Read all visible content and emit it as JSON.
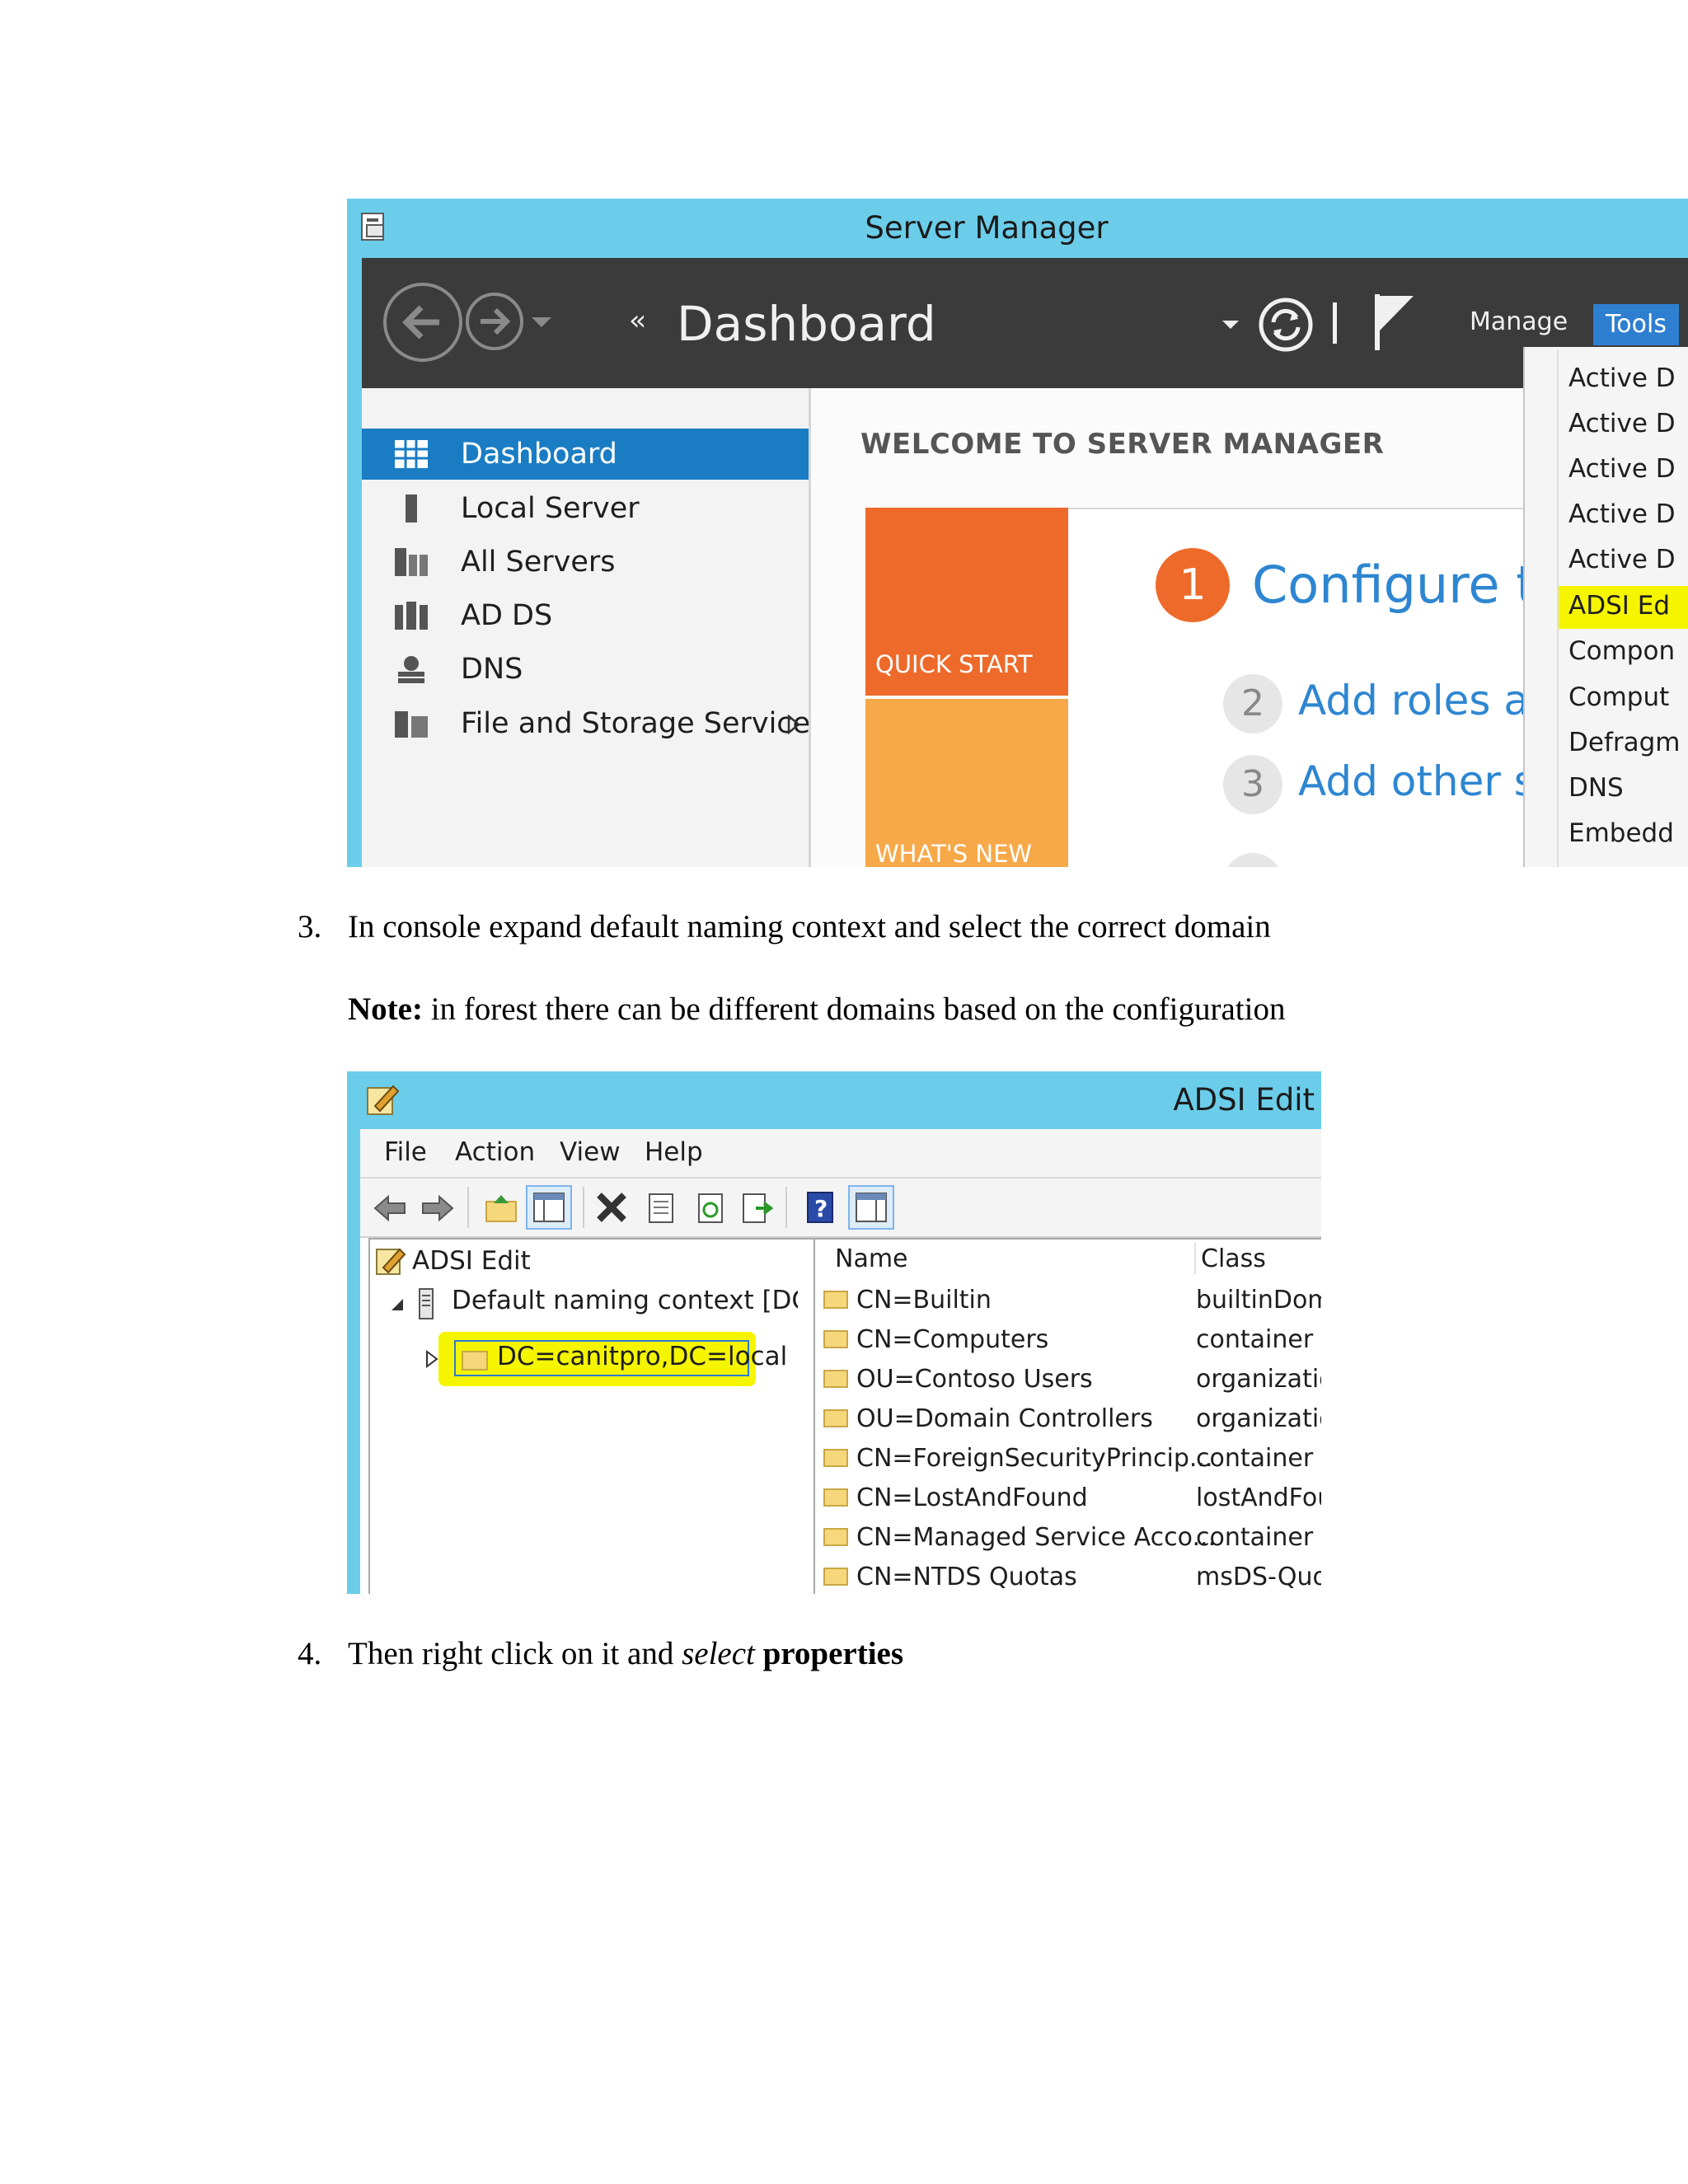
{
  "server_manager": {
    "title": "Server Manager",
    "header_title": "Dashboard",
    "header_chevrons": "‹‹",
    "manage": "Manage",
    "tools": "Tools",
    "sidebar": [
      {
        "label": "Dashboard",
        "icon": "dashboard-icon"
      },
      {
        "label": "Local Server",
        "icon": "server-icon"
      },
      {
        "label": "All Servers",
        "icon": "servers-icon"
      },
      {
        "label": "AD DS",
        "icon": "adds-icon"
      },
      {
        "label": "DNS",
        "icon": "dns-icon"
      },
      {
        "label": "File and Storage Services",
        "icon": "storage-icon"
      }
    ],
    "welcome": "WELCOME TO SERVER MANAGER",
    "quick_start": "QUICK START",
    "whats_new": "WHAT'S NEW",
    "steps": [
      {
        "num": "1",
        "text": "Configure thi"
      },
      {
        "num": "2",
        "text": "Add roles and"
      },
      {
        "num": "3",
        "text": "Add other se"
      }
    ],
    "tools_menu": [
      "Active D",
      "Active D",
      "Active D",
      "Active D",
      "Active D",
      "ADSI Ed",
      "Compon",
      "Comput",
      "Defragm",
      "DNS",
      "Embedd"
    ],
    "colors": {
      "titlebar": "#6bcdea",
      "header": "#3b3b3c",
      "accent": "#1a7dc4",
      "highlight": "#f5f500",
      "quick_start": "#ee6a2a"
    }
  },
  "step3": {
    "num": "3.",
    "text": "In console expand default naming context and select the correct domain"
  },
  "note": {
    "label": "Note:",
    "text": " in forest there can be different domains based on the configuration"
  },
  "adsi": {
    "title": "ADSI Edit",
    "menu": [
      "File",
      "Action",
      "View",
      "Help"
    ],
    "tree": {
      "root": "ADSI Edit",
      "context": "Default naming context [DC.car",
      "selected": "DC=canitpro,DC=local"
    },
    "columns": {
      "name": "Name",
      "class": "Class"
    },
    "rows": [
      {
        "name": "CN=Builtin",
        "class": "builtinDom"
      },
      {
        "name": "CN=Computers",
        "class": "container"
      },
      {
        "name": "OU=Contoso Users",
        "class": "organizatio"
      },
      {
        "name": "OU=Domain Controllers",
        "class": "organizatio"
      },
      {
        "name": "CN=ForeignSecurityPrincip...",
        "class": "container"
      },
      {
        "name": "CN=LostAndFound",
        "class": "lostAndFou"
      },
      {
        "name": "CN=Managed Service Acco...",
        "class": "container"
      },
      {
        "name": "CN=NTDS Quotas",
        "class": "msDS-Quo"
      }
    ]
  },
  "step4": {
    "num": "4.",
    "text_a": "Then right click on it and ",
    "text_b": "select",
    "text_c": " ",
    "text_d": "properties"
  }
}
